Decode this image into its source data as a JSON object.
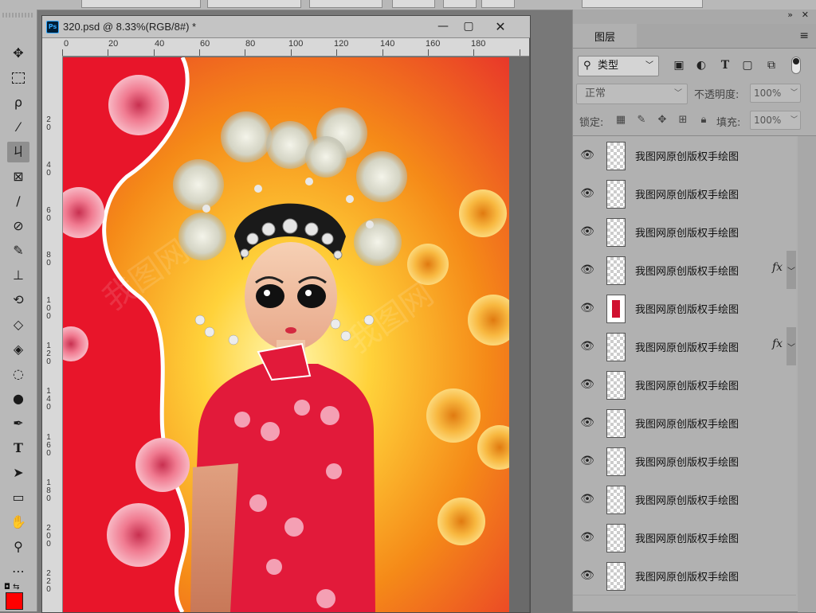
{
  "document": {
    "title": "320.psd @ 8.33%(RGB/8#) *",
    "badge": "Ps",
    "ruler_top": [
      "0",
      "20",
      "40",
      "60",
      "80",
      "100",
      "120",
      "140",
      "160",
      "180"
    ],
    "ruler_left": [
      "2\n0",
      "4\n0",
      "6\n0",
      "8\n0",
      "1\n0\n0",
      "1\n2\n0",
      "1\n4\n0",
      "1\n6\n0",
      "1\n8\n0",
      "2\n0\n0",
      "2\n2\n0"
    ]
  },
  "layers_panel": {
    "tab": "图层",
    "filter": {
      "label": "类型"
    },
    "blend_mode": "正常",
    "opacity_label": "不透明度:",
    "opacity_value": "100%",
    "lock_label": "锁定:",
    "fill_label": "填充:",
    "fill_value": "100%",
    "layers": [
      {
        "name": "我图网原创版权手绘图",
        "fx": false
      },
      {
        "name": "我图网原创版权手绘图",
        "fx": false
      },
      {
        "name": "我图网原创版权手绘图",
        "fx": false
      },
      {
        "name": "我图网原创版权手绘图",
        "fx": true
      },
      {
        "name": "我图网原创版权手绘图",
        "fx": false
      },
      {
        "name": "我图网原创版权手绘图",
        "fx": true
      },
      {
        "name": "我图网原创版权手绘图",
        "fx": false
      },
      {
        "name": "我图网原创版权手绘图",
        "fx": false
      },
      {
        "name": "我图网原创版权手绘图",
        "fx": false
      },
      {
        "name": "我图网原创版权手绘图",
        "fx": false
      },
      {
        "name": "我图网原创版权手绘图",
        "fx": false
      },
      {
        "name": "我图网原创版权手绘图",
        "fx": false
      }
    ],
    "fx_label": "fx"
  },
  "colors": {
    "foreground": "#ff0000",
    "canvas_left_red": "#e8152a",
    "canvas_orange": "#f06a18",
    "dress_red": "#e21a3a"
  },
  "tools": [
    "move-icon",
    "marquee-icon",
    "lasso-icon",
    "magic-wand-icon",
    "crop-icon",
    "frame-icon",
    "eyedropper-icon",
    "healing-icon",
    "brush-icon",
    "stamp-icon",
    "history-brush-icon",
    "eraser-icon",
    "paint-bucket-icon",
    "blur-icon",
    "dodge-icon",
    "pen-icon",
    "type-icon",
    "path-select-icon",
    "rectangle-icon",
    "hand-icon",
    "zoom-icon",
    "more-icon"
  ]
}
